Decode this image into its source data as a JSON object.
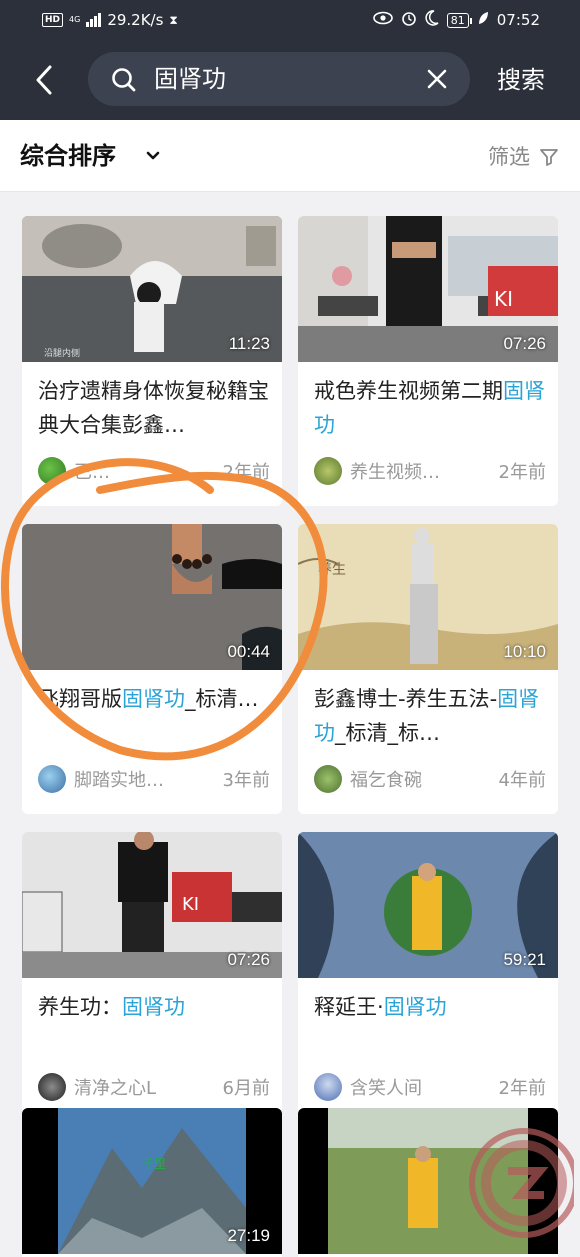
{
  "status_bar": {
    "hd": "HD",
    "network": "4G",
    "speed": "29.2K/s",
    "battery": "81",
    "time": "07:52"
  },
  "search": {
    "query": "固肾功",
    "submit_label": "搜索"
  },
  "sort": {
    "label": "综合排序",
    "filter_label": "筛选"
  },
  "videos": [
    {
      "duration": "11:23",
      "title_parts": [
        "治疗遗精身体恢复秘籍宝典大合集彭鑫…"
      ],
      "author": "已…",
      "time": "2年前"
    },
    {
      "duration": "07:26",
      "title_parts": [
        "戒色养生视频第二期",
        "固肾功"
      ],
      "author": "养生视频…",
      "time": "2年前"
    },
    {
      "duration": "00:44",
      "title_parts": [
        "飞翔哥版",
        "固肾功",
        "_标清…"
      ],
      "author": "脚踏实地…",
      "time": "3年前"
    },
    {
      "duration": "10:10",
      "title_parts": [
        "彭鑫博士-养生五法-",
        "固肾功",
        "_标清_标…"
      ],
      "author": "福乞食碗",
      "time": "4年前"
    },
    {
      "duration": "07:26",
      "title_parts": [
        "养生功：",
        "固肾功"
      ],
      "author": "清净之心L",
      "time": "6月前"
    },
    {
      "duration": "59:21",
      "title_parts": [
        "释延王·",
        "固肾功"
      ],
      "author": "含笑人间",
      "time": "2年前"
    },
    {
      "duration": "27:19",
      "title_parts": [],
      "author": "",
      "time": ""
    },
    {
      "duration": "",
      "title_parts": [],
      "author": "",
      "time": ""
    }
  ],
  "colors": {
    "header_bg": "#2b303b",
    "highlight": "#2aa3d6",
    "annotation": "#f08c3c"
  }
}
